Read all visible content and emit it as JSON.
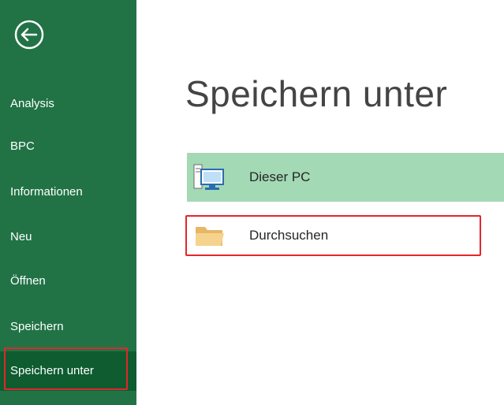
{
  "sidebar": {
    "back_icon": "back-arrow-icon",
    "items": [
      {
        "label": "Analysis"
      },
      {
        "label": "BPC"
      },
      {
        "label": "Informationen"
      },
      {
        "label": "Neu"
      },
      {
        "label": "Öffnen"
      },
      {
        "label": "Speichern"
      },
      {
        "label": "Speichern unter",
        "active": true
      }
    ]
  },
  "main": {
    "title": "Speichern unter",
    "locations": [
      {
        "label": "Dieser PC",
        "icon": "computer-icon",
        "selected": true
      },
      {
        "label": "Durchsuchen",
        "icon": "folder-icon",
        "selected": false
      }
    ]
  },
  "colors": {
    "sidebar_bg": "#217346",
    "sidebar_active_bg": "#0e5c30",
    "selected_location_bg": "#a3d9b5",
    "highlight_border": "#e3262b"
  }
}
